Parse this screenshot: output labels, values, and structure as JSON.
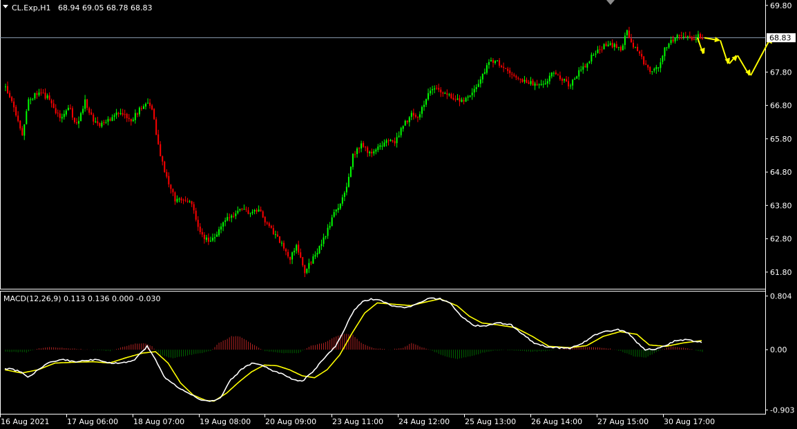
{
  "header": {
    "symbol": "CL.Exp,H1",
    "ohlc": "68.94 69.05 68.78 68.83"
  },
  "macd_header": "MACD(12,26,9) 0.113 0.136 0.000 -0.030",
  "colors": {
    "background": "#000000",
    "bull": "#00ff00",
    "bear": "#ff0000",
    "macd_line": "#ffffff",
    "signal_line": "#ffff00",
    "hist_pos": "#b22222",
    "hist_neg": "#006400",
    "projection": "#ffff00",
    "price_line": "#8c9bb0",
    "axis": "#ffffff",
    "marker": "#8c8c8c"
  },
  "chart_data": [
    {
      "type": "candlestick",
      "title": "CL.Exp,H1",
      "ylim": [
        61.3,
        69.9
      ],
      "y_ticks": [
        "69.80",
        "68.83",
        "67.80",
        "66.80",
        "65.80",
        "64.80",
        "63.80",
        "62.80",
        "61.80"
      ],
      "last_price_label": "68.83",
      "x_labels": [
        "16 Aug 2021",
        "17 Aug 06:00",
        "18 Aug 07:00",
        "19 Aug 08:00",
        "20 Aug 09:00",
        "23 Aug 11:00",
        "24 Aug 12:00",
        "25 Aug 13:00",
        "26 Aug 14:00",
        "27 Aug 15:00",
        "30 Aug 17:00"
      ],
      "anchors": [
        [
          0,
          67.35
        ],
        [
          3,
          67.0
        ],
        [
          6,
          66.3
        ],
        [
          8,
          65.9
        ],
        [
          11,
          67.0
        ],
        [
          15,
          67.15
        ],
        [
          20,
          67.05
        ],
        [
          24,
          66.6
        ],
        [
          27,
          66.4
        ],
        [
          30,
          66.8
        ],
        [
          34,
          66.2
        ],
        [
          38,
          66.9
        ],
        [
          42,
          66.3
        ],
        [
          47,
          66.2
        ],
        [
          51,
          66.5
        ],
        [
          55,
          66.6
        ],
        [
          60,
          66.3
        ],
        [
          64,
          66.7
        ],
        [
          68,
          66.9
        ],
        [
          70,
          66.7
        ],
        [
          73,
          65.6
        ],
        [
          77,
          64.6
        ],
        [
          81,
          64.0
        ],
        [
          85,
          64.0
        ],
        [
          89,
          63.9
        ],
        [
          93,
          63.0
        ],
        [
          97,
          62.7
        ],
        [
          101,
          62.9
        ],
        [
          105,
          63.4
        ],
        [
          109,
          63.5
        ],
        [
          113,
          63.7
        ],
        [
          117,
          63.5
        ],
        [
          121,
          63.7
        ],
        [
          124,
          63.3
        ],
        [
          128,
          63.0
        ],
        [
          132,
          62.6
        ],
        [
          136,
          62.2
        ],
        [
          139,
          62.6
        ],
        [
          143,
          61.8
        ],
        [
          147,
          62.2
        ],
        [
          151,
          62.7
        ],
        [
          155,
          63.2
        ],
        [
          158,
          63.7
        ],
        [
          162,
          64.1
        ],
        [
          166,
          65.3
        ],
        [
          170,
          65.6
        ],
        [
          174,
          65.4
        ],
        [
          178,
          65.5
        ],
        [
          182,
          65.7
        ],
        [
          186,
          65.7
        ],
        [
          190,
          66.2
        ],
        [
          194,
          66.5
        ],
        [
          198,
          66.5
        ],
        [
          202,
          67.2
        ],
        [
          206,
          67.3
        ],
        [
          210,
          67.2
        ],
        [
          214,
          67.0
        ],
        [
          218,
          66.9
        ],
        [
          222,
          67.1
        ],
        [
          226,
          67.5
        ],
        [
          230,
          68.0
        ],
        [
          234,
          68.2
        ],
        [
          238,
          67.9
        ],
        [
          242,
          67.8
        ],
        [
          246,
          67.6
        ],
        [
          250,
          67.5
        ],
        [
          254,
          67.4
        ],
        [
          258,
          67.5
        ],
        [
          262,
          67.8
        ],
        [
          266,
          67.6
        ],
        [
          270,
          67.4
        ],
        [
          274,
          67.8
        ],
        [
          278,
          68.1
        ],
        [
          282,
          68.4
        ],
        [
          286,
          68.6
        ],
        [
          290,
          68.6
        ],
        [
          294,
          68.5
        ],
        [
          297,
          69.0
        ],
        [
          300,
          68.6
        ],
        [
          303,
          68.3
        ],
        [
          306,
          68.0
        ],
        [
          309,
          67.8
        ],
        [
          312,
          68.0
        ],
        [
          315,
          68.5
        ],
        [
          318,
          68.7
        ],
        [
          321,
          68.9
        ],
        [
          325,
          68.9
        ],
        [
          329,
          68.7
        ],
        [
          331,
          68.95
        ],
        [
          333,
          68.83
        ]
      ],
      "projection": [
        [
          68.83,
          68.35
        ],
        [
          68.83,
          68.75
        ],
        [
          68.75,
          68.05
        ],
        [
          68.05,
          68.3
        ],
        [
          68.3,
          67.7
        ],
        [
          67.7,
          68.83
        ]
      ]
    },
    {
      "type": "macd",
      "title": "MACD(12,26,9)",
      "values": {
        "macd": 0.113,
        "signal": 0.136,
        "hist_a": 0.0,
        "hist_b": -0.03
      },
      "ylim": [
        -0.95,
        0.85
      ],
      "y_ticks": [
        "0.804",
        "0.00",
        "-0.903"
      ],
      "macd_anchors": [
        [
          0,
          -0.28
        ],
        [
          4,
          -0.3
        ],
        [
          8,
          -0.33
        ],
        [
          11,
          -0.42
        ],
        [
          16,
          -0.3
        ],
        [
          22,
          -0.18
        ],
        [
          28,
          -0.15
        ],
        [
          34,
          -0.18
        ],
        [
          40,
          -0.16
        ],
        [
          44,
          -0.14
        ],
        [
          50,
          -0.2
        ],
        [
          56,
          -0.2
        ],
        [
          62,
          -0.15
        ],
        [
          68,
          0.05
        ],
        [
          72,
          -0.15
        ],
        [
          76,
          -0.4
        ],
        [
          82,
          -0.55
        ],
        [
          88,
          -0.65
        ],
        [
          93,
          -0.75
        ],
        [
          98,
          -0.78
        ],
        [
          103,
          -0.72
        ],
        [
          108,
          -0.45
        ],
        [
          113,
          -0.3
        ],
        [
          118,
          -0.2
        ],
        [
          122,
          -0.22
        ],
        [
          127,
          -0.3
        ],
        [
          133,
          -0.37
        ],
        [
          138,
          -0.45
        ],
        [
          142,
          -0.48
        ],
        [
          148,
          -0.3
        ],
        [
          152,
          -0.15
        ],
        [
          158,
          0.05
        ],
        [
          163,
          0.35
        ],
        [
          167,
          0.6
        ],
        [
          171,
          0.72
        ],
        [
          175,
          0.76
        ],
        [
          180,
          0.73
        ],
        [
          186,
          0.65
        ],
        [
          192,
          0.63
        ],
        [
          198,
          0.7
        ],
        [
          203,
          0.77
        ],
        [
          208,
          0.76
        ],
        [
          213,
          0.7
        ],
        [
          218,
          0.5
        ],
        [
          224,
          0.36
        ],
        [
          230,
          0.36
        ],
        [
          236,
          0.4
        ],
        [
          242,
          0.37
        ],
        [
          248,
          0.22
        ],
        [
          253,
          0.1
        ],
        [
          258,
          0.05
        ],
        [
          264,
          0.03
        ],
        [
          270,
          0.02
        ],
        [
          276,
          0.1
        ],
        [
          282,
          0.22
        ],
        [
          288,
          0.28
        ],
        [
          293,
          0.3
        ],
        [
          298,
          0.25
        ],
        [
          303,
          0.08
        ],
        [
          306,
          0.0
        ],
        [
          311,
          0.01
        ],
        [
          315,
          0.05
        ],
        [
          320,
          0.13
        ],
        [
          325,
          0.15
        ],
        [
          329,
          0.13
        ],
        [
          333,
          0.113
        ]
      ],
      "signal_anchors": [
        [
          0,
          -0.3
        ],
        [
          8,
          -0.35
        ],
        [
          16,
          -0.3
        ],
        [
          24,
          -0.2
        ],
        [
          32,
          -0.19
        ],
        [
          42,
          -0.18
        ],
        [
          50,
          -0.2
        ],
        [
          58,
          -0.12
        ],
        [
          66,
          -0.05
        ],
        [
          72,
          -0.03
        ],
        [
          78,
          -0.2
        ],
        [
          84,
          -0.5
        ],
        [
          90,
          -0.68
        ],
        [
          96,
          -0.76
        ],
        [
          100,
          -0.77
        ],
        [
          106,
          -0.65
        ],
        [
          112,
          -0.48
        ],
        [
          118,
          -0.33
        ],
        [
          124,
          -0.23
        ],
        [
          130,
          -0.24
        ],
        [
          136,
          -0.3
        ],
        [
          142,
          -0.39
        ],
        [
          148,
          -0.42
        ],
        [
          154,
          -0.3
        ],
        [
          160,
          -0.08
        ],
        [
          166,
          0.25
        ],
        [
          172,
          0.55
        ],
        [
          178,
          0.7
        ],
        [
          186,
          0.68
        ],
        [
          194,
          0.66
        ],
        [
          202,
          0.72
        ],
        [
          208,
          0.76
        ],
        [
          216,
          0.66
        ],
        [
          222,
          0.5
        ],
        [
          228,
          0.4
        ],
        [
          236,
          0.37
        ],
        [
          244,
          0.33
        ],
        [
          252,
          0.2
        ],
        [
          260,
          0.05
        ],
        [
          270,
          0.03
        ],
        [
          278,
          0.06
        ],
        [
          286,
          0.2
        ],
        [
          294,
          0.27
        ],
        [
          302,
          0.23
        ],
        [
          308,
          0.07
        ],
        [
          316,
          0.05
        ],
        [
          324,
          0.1
        ],
        [
          333,
          0.136
        ]
      ],
      "hist_anchors": [
        [
          0,
          -0.03
        ],
        [
          10,
          -0.04
        ],
        [
          16,
          0.02
        ],
        [
          22,
          0.04
        ],
        [
          30,
          0.02
        ],
        [
          40,
          0.0
        ],
        [
          50,
          -0.02
        ],
        [
          56,
          0.04
        ],
        [
          62,
          0.09
        ],
        [
          66,
          0.1
        ],
        [
          70,
          0.05
        ],
        [
          74,
          -0.08
        ],
        [
          80,
          -0.13
        ],
        [
          88,
          -0.08
        ],
        [
          94,
          -0.05
        ],
        [
          98,
          -0.02
        ],
        [
          102,
          0.1
        ],
        [
          108,
          0.2
        ],
        [
          112,
          0.2
        ],
        [
          118,
          0.08
        ],
        [
          124,
          -0.02
        ],
        [
          132,
          -0.05
        ],
        [
          140,
          -0.05
        ],
        [
          146,
          0.06
        ],
        [
          152,
          0.1
        ],
        [
          158,
          0.2
        ],
        [
          162,
          0.24
        ],
        [
          166,
          0.22
        ],
        [
          170,
          0.1
        ],
        [
          176,
          0.02
        ],
        [
          184,
          0.0
        ],
        [
          190,
          0.03
        ],
        [
          194,
          0.1
        ],
        [
          198,
          0.05
        ],
        [
          204,
          -0.02
        ],
        [
          210,
          -0.1
        ],
        [
          216,
          -0.14
        ],
        [
          222,
          -0.1
        ],
        [
          230,
          -0.03
        ],
        [
          238,
          0.0
        ],
        [
          246,
          -0.02
        ],
        [
          252,
          -0.03
        ],
        [
          258,
          -0.02
        ],
        [
          266,
          0.01
        ],
        [
          272,
          0.04
        ],
        [
          280,
          0.04
        ],
        [
          288,
          0.02
        ],
        [
          294,
          -0.02
        ],
        [
          300,
          -0.1
        ],
        [
          306,
          -0.12
        ],
        [
          312,
          -0.02
        ],
        [
          318,
          0.05
        ],
        [
          324,
          0.03
        ],
        [
          333,
          -0.03
        ]
      ]
    }
  ]
}
